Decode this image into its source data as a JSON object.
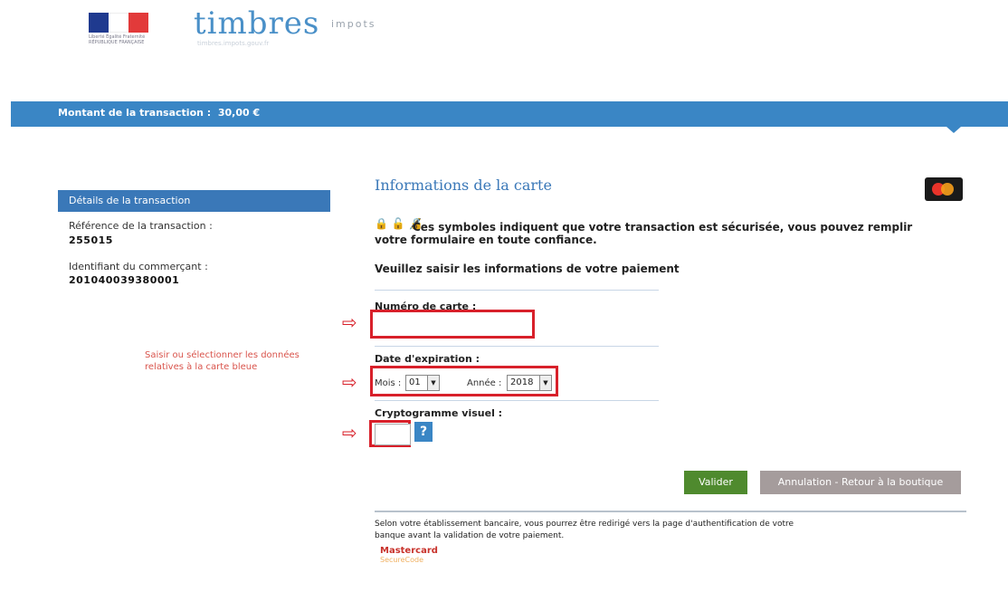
{
  "header": {
    "flag_caption": "Liberté Égalité Fraternité RÉPUBLIQUE FRANÇAISE",
    "brand": "timbres",
    "brand_sub": "impots",
    "brand_tagline": "timbres.impots.gouv.fr"
  },
  "bluebar": {
    "amount_label": "Montant de la transaction :",
    "amount_value": "30,00 €"
  },
  "sidebar": {
    "title": "Détails de la transaction",
    "ref_label": "Référence de la transaction :",
    "ref_value": "255015",
    "merchant_label": "Identifiant du commerçant :",
    "merchant_value": "201040039380001",
    "hint": "Saisir ou sélectionner les données relatives à la carte bleue"
  },
  "form": {
    "title": "Informations de la carte",
    "security_icons": "🔒 🔓 🔏",
    "security_text": "Ces symboles indiquent que votre transaction est sécurisée, vous pouvez remplir votre formulaire en toute confiance.",
    "heading": "Veuillez saisir les informations de votre paiement",
    "card_number_label": "Numéro de carte :",
    "card_number_value": "",
    "expiry_label": "Date d'expiration :",
    "month_label": "Mois :",
    "month_value": "01",
    "year_label": "Année :",
    "year_value": "2018",
    "cvv_label": "Cryptogramme visuel :",
    "cvv_value": "",
    "help_label": "?",
    "arrow": "⇨"
  },
  "buttons": {
    "validate": "Valider",
    "cancel": "Annulation - Retour à la boutique"
  },
  "footer": {
    "notice": "Selon votre établissement bancaire, vous pourrez être redirigé vers la page d'authentification de votre banque avant la validation de votre paiement.",
    "mc_brand": "Mastercard",
    "mc_sub": "SecureCode"
  },
  "colors": {
    "accent_blue": "#3a86c5",
    "highlight_red": "#d8202a",
    "validate_green": "#4f8a2e",
    "cancel_gray": "#a59c9c"
  }
}
